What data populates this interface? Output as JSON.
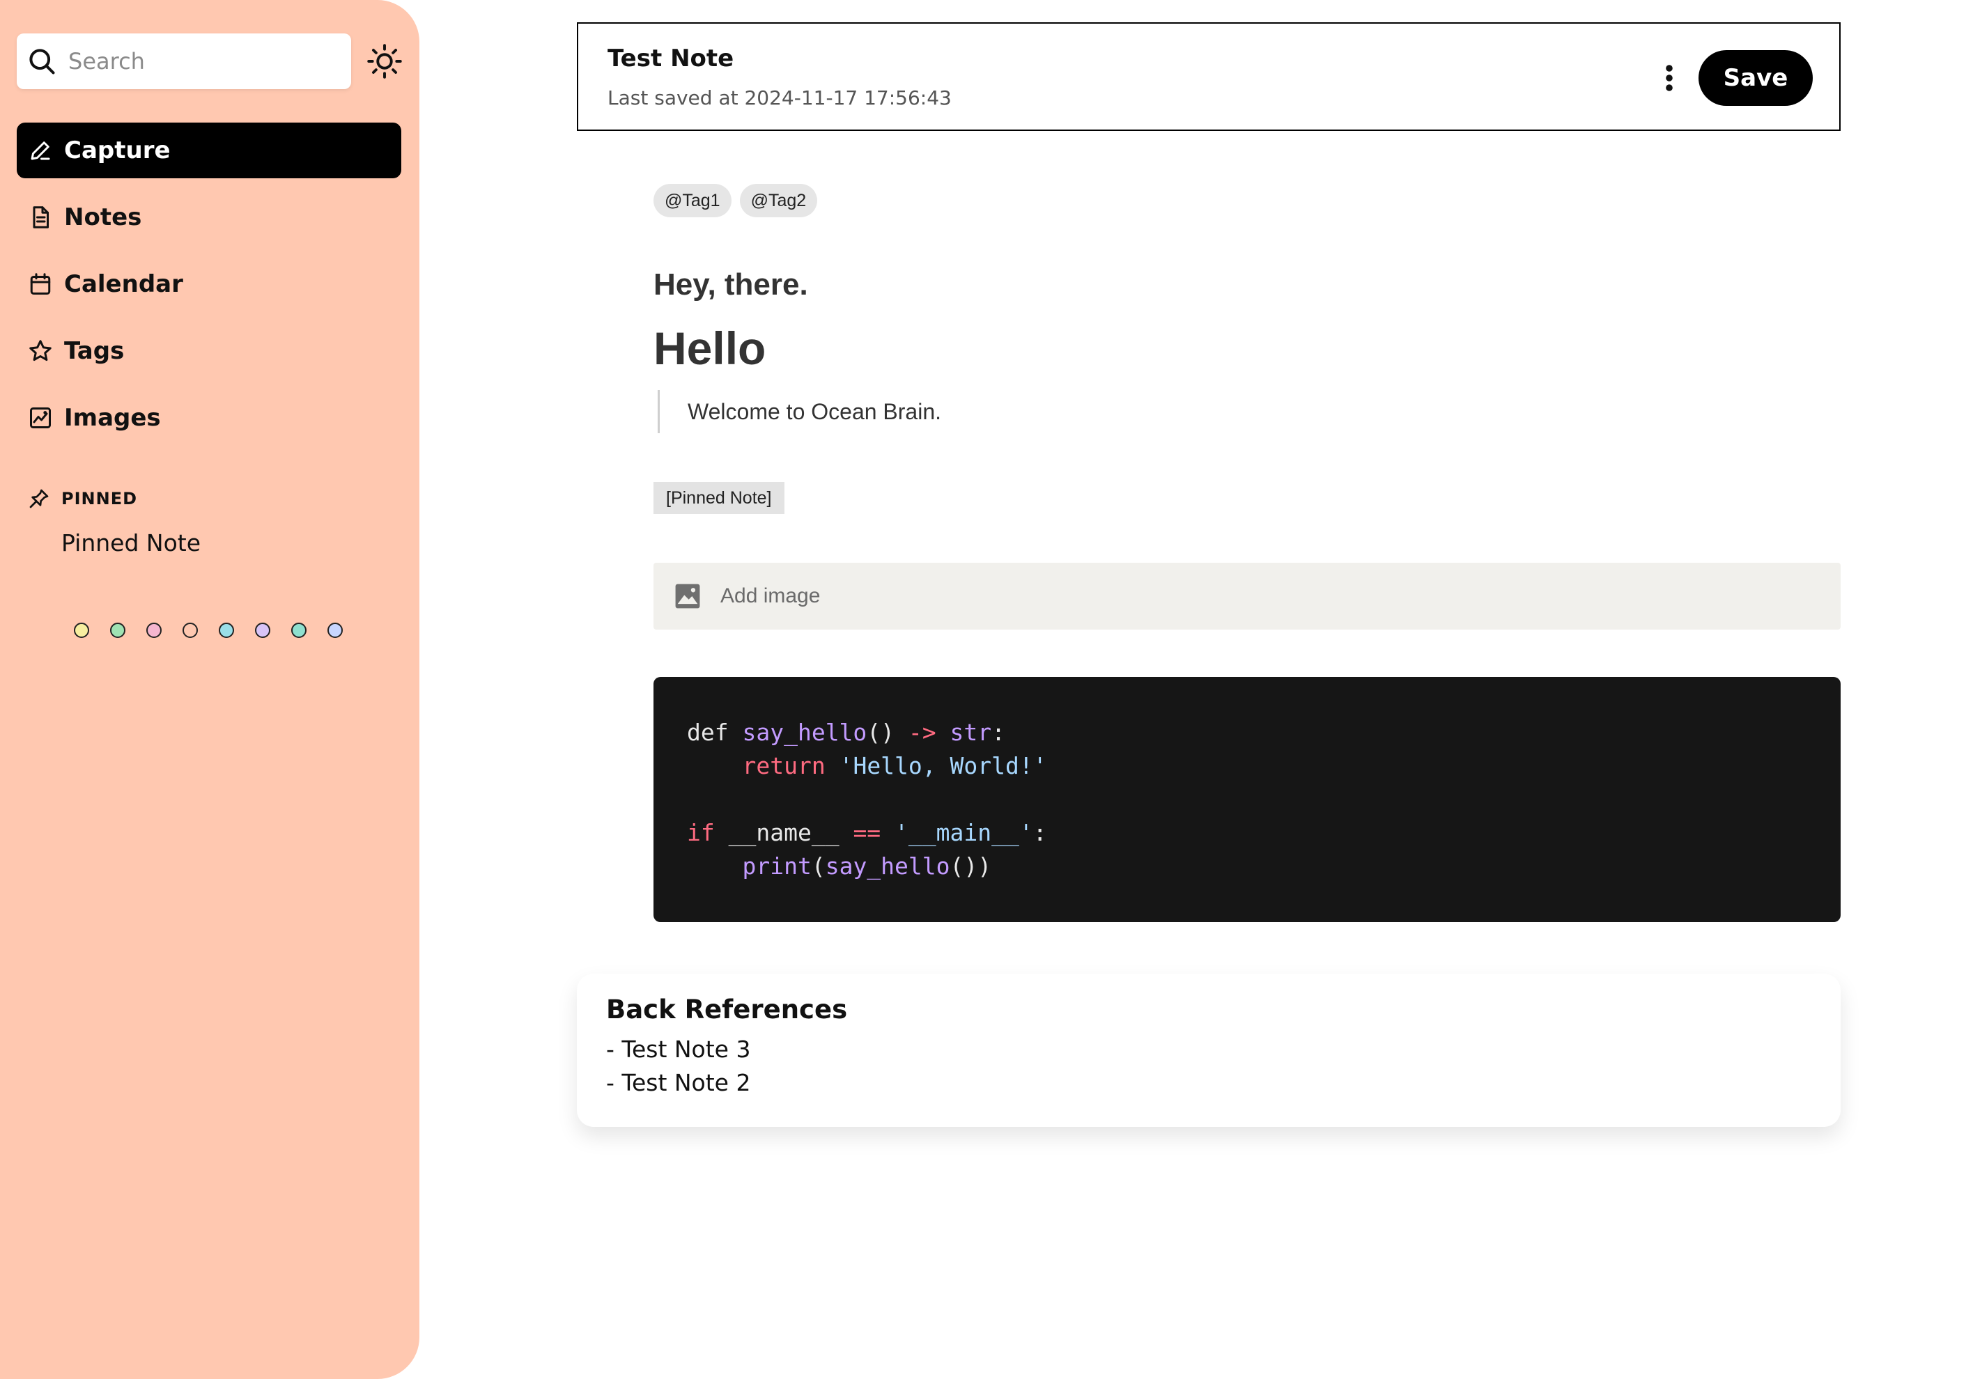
{
  "sidebar": {
    "search": {
      "placeholder": "Search",
      "value": "",
      "icon": "search-icon"
    },
    "theme_toggle_icon": "sun-icon",
    "background_color": "#ffc8b0",
    "items": [
      {
        "label": "Capture",
        "icon": "pencil-icon",
        "active": true
      },
      {
        "label": "Notes",
        "icon": "document-icon",
        "active": false
      },
      {
        "label": "Calendar",
        "icon": "calendar-icon",
        "active": false
      },
      {
        "label": "Tags",
        "icon": "star-icon",
        "active": false
      },
      {
        "label": "Images",
        "icon": "image-icon",
        "active": false
      }
    ],
    "pinned": {
      "header": "PINNED",
      "icon": "pin-icon",
      "items": [
        "Pinned Note"
      ]
    },
    "color_dots": [
      "#f7eea0",
      "#9fe3b3",
      "#f5b6cf",
      "#ffc8b0",
      "#9adfe8",
      "#d8c4f7",
      "#8fe0cf",
      "#c8d6ff"
    ]
  },
  "header": {
    "title": "Test Note",
    "last_saved": "Last saved at 2024-11-17 17:56:43",
    "more_icon": "more-vertical-icon",
    "save_label": "Save"
  },
  "editor": {
    "tags": [
      "@Tag1",
      "@Tag2"
    ],
    "subheading": "Hey, there.",
    "heading": "Hello",
    "quote": "Welcome to Ocean Brain.",
    "pinned_link": "[Pinned Note]",
    "add_image": {
      "label": "Add image",
      "icon": "image-placeholder-icon"
    },
    "code": {
      "language": "python",
      "lines": [
        [
          {
            "t": "def ",
            "c": "plain"
          },
          {
            "t": "say_hello",
            "c": "fn"
          },
          {
            "t": "() ",
            "c": "plain"
          },
          {
            "t": "->",
            "c": "kw"
          },
          {
            "t": " ",
            "c": "plain"
          },
          {
            "t": "str",
            "c": "fn"
          },
          {
            "t": ":",
            "c": "plain"
          }
        ],
        [
          {
            "t": "    ",
            "c": "plain"
          },
          {
            "t": "return",
            "c": "kw"
          },
          {
            "t": " ",
            "c": "plain"
          },
          {
            "t": "'Hello, World!'",
            "c": "str"
          }
        ],
        [],
        [
          {
            "t": "if",
            "c": "kw"
          },
          {
            "t": " __name__ ",
            "c": "plain"
          },
          {
            "t": "==",
            "c": "kw"
          },
          {
            "t": " ",
            "c": "plain"
          },
          {
            "t": "'__main__'",
            "c": "str"
          },
          {
            "t": ":",
            "c": "plain"
          }
        ],
        [
          {
            "t": "    ",
            "c": "plain"
          },
          {
            "t": "print",
            "c": "fn"
          },
          {
            "t": "(",
            "c": "plain"
          },
          {
            "t": "say_hello",
            "c": "fn"
          },
          {
            "t": "())",
            "c": "plain"
          }
        ]
      ]
    }
  },
  "back_references": {
    "title": "Back References",
    "items": [
      "- Test Note 3",
      "- Test Note 2"
    ]
  }
}
